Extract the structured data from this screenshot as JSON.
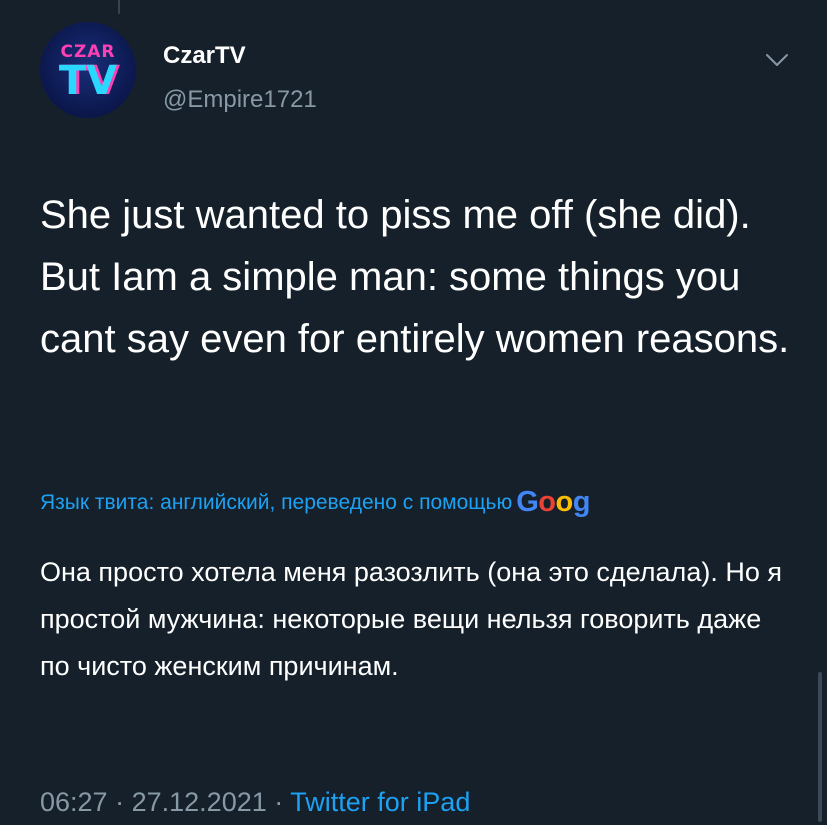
{
  "author": {
    "avatar_top_text": "CZAR",
    "avatar_bottom_text": "TV",
    "display_name": "CzarTV",
    "handle": "@Empire1721"
  },
  "tweet": {
    "text": "She just wanted to piss me off (she did). But Iam a simple man: some things you cant say even for entirely women reasons."
  },
  "translation": {
    "label": "Язык твита: английский, переведено с помощью",
    "provider_letters": [
      "G",
      "o",
      "o",
      "g"
    ],
    "text": "Она просто хотела меня разозлить (она это сделала). Но я простой мужчина: некоторые вещи нельзя говорить даже по чисто женским причинам."
  },
  "meta": {
    "time": "06:27",
    "separator": "·",
    "date": "27.12.2021",
    "source": "Twitter for iPad"
  },
  "colors": {
    "background": "#15202b",
    "text": "#ffffff",
    "secondary_text": "#8899a6",
    "accent": "#1da1f2",
    "google_blue": "#4285f4",
    "google_red": "#ea4335",
    "google_yellow": "#fbbc05",
    "google_green": "#34a853"
  },
  "icons": {
    "more_menu": "chevron-down-icon"
  }
}
